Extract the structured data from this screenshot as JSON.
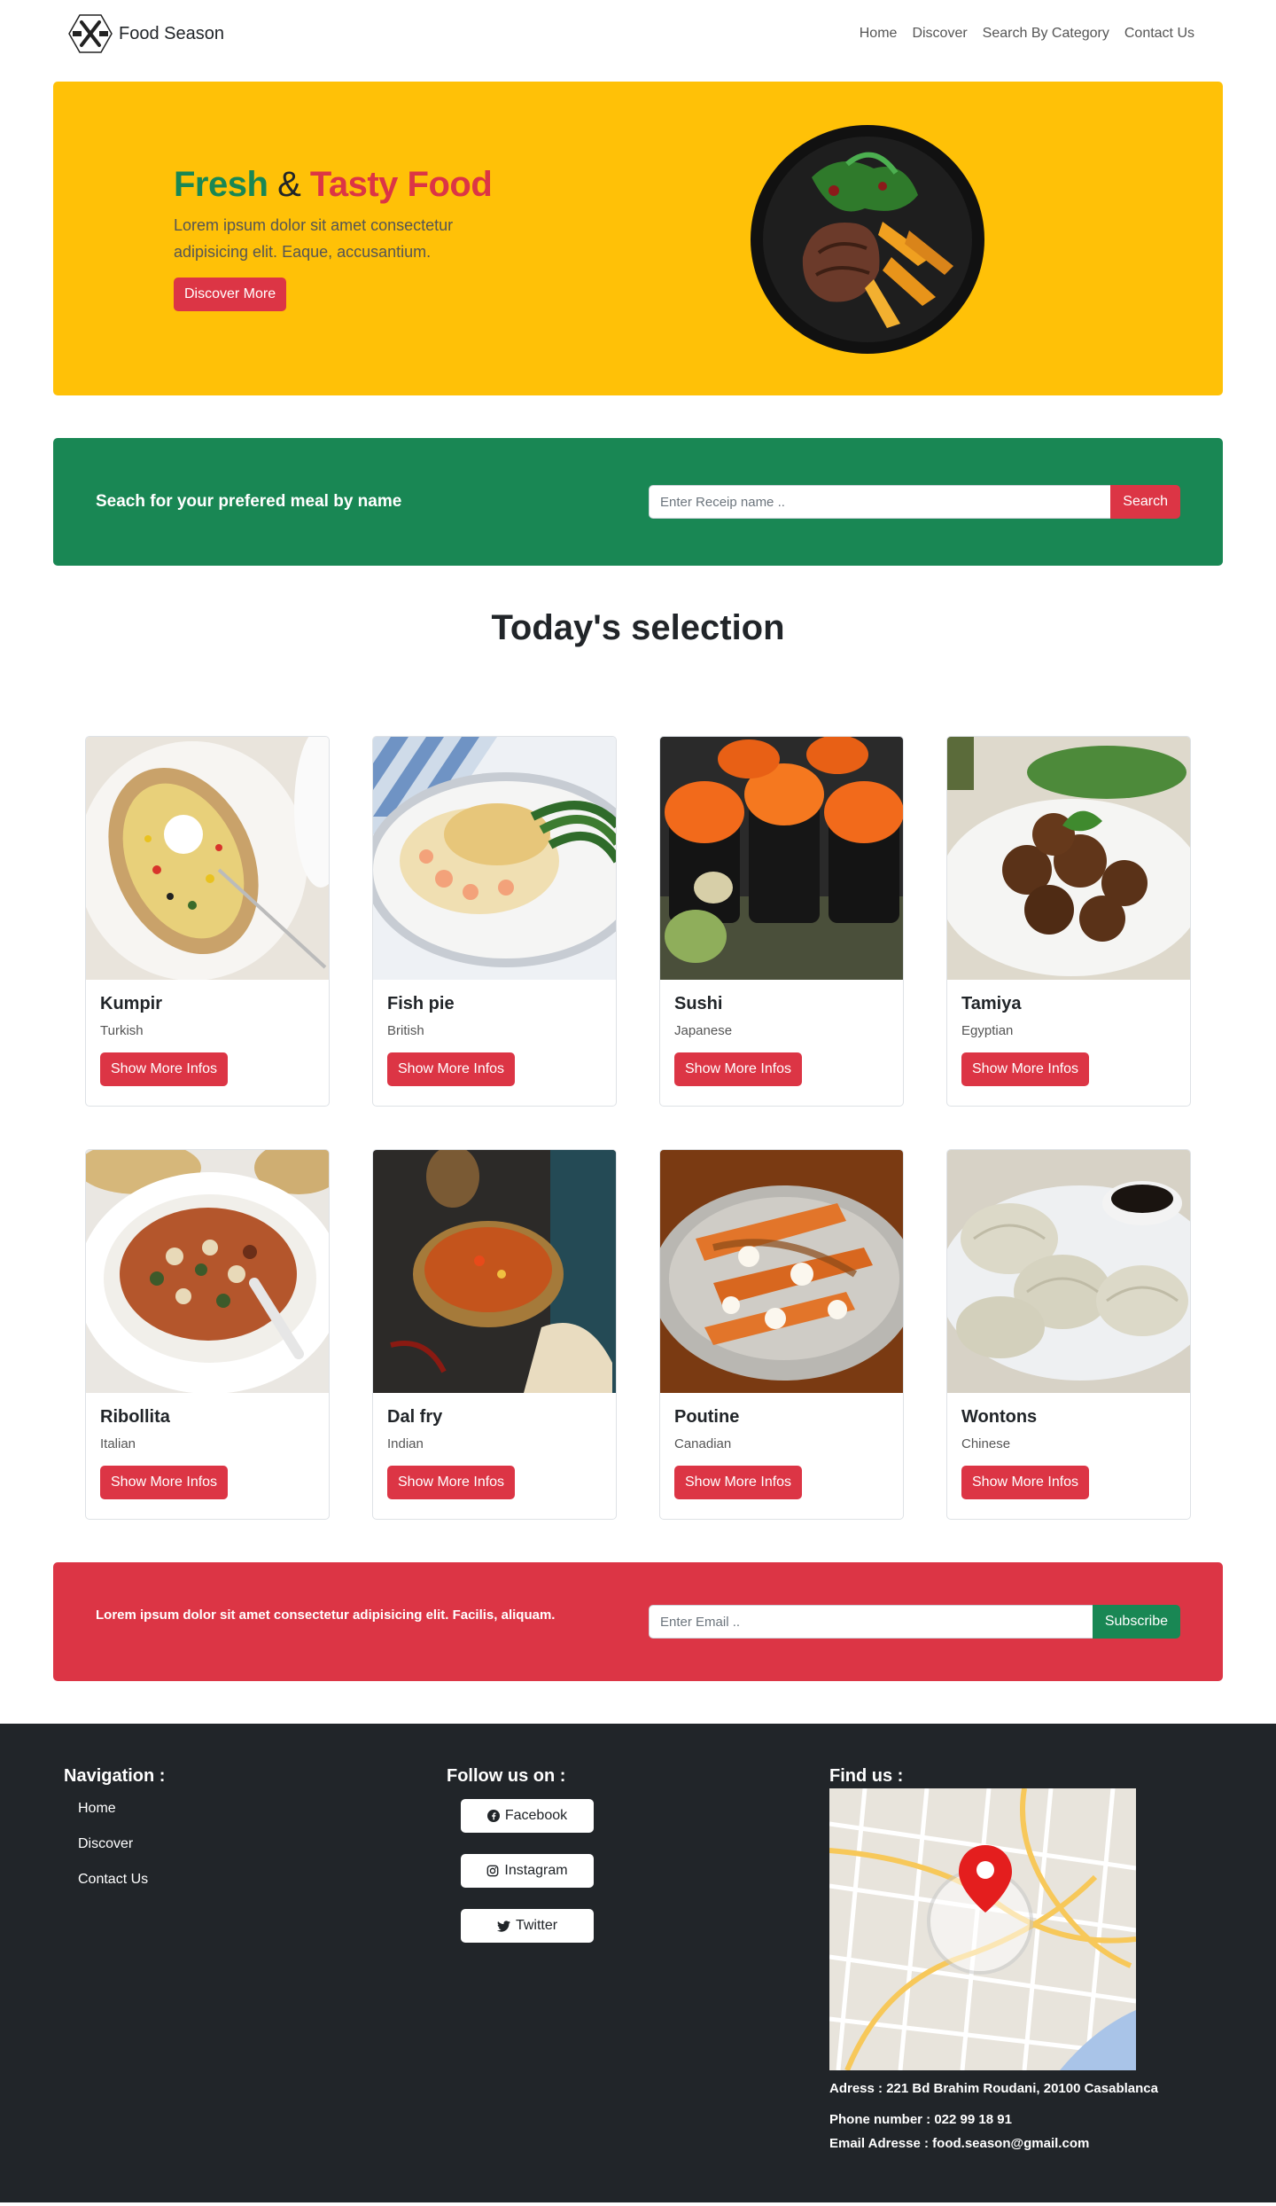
{
  "nav": {
    "brand": "Food Season",
    "links": [
      "Home",
      "Discover",
      "Search By Category",
      "Contact Us"
    ]
  },
  "hero": {
    "title_fresh": "Fresh",
    "title_amp": "&",
    "title_tasty": "Tasty Food",
    "subtitle": "Lorem ipsum dolor sit amet consectetur adipisicing elit. Eaque, accusantium.",
    "button": "Discover More"
  },
  "search": {
    "label": "Seach for your prefered meal by name",
    "placeholder": "Enter Receip name ..",
    "button": "Search"
  },
  "selection": {
    "title": "Today's selection",
    "button": "Show More Infos",
    "cards": [
      {
        "name": "Kumpir",
        "origin": "Turkish"
      },
      {
        "name": "Fish pie",
        "origin": "British"
      },
      {
        "name": "Sushi",
        "origin": "Japanese"
      },
      {
        "name": "Tamiya",
        "origin": "Egyptian"
      },
      {
        "name": "Ribollita",
        "origin": "Italian"
      },
      {
        "name": "Dal fry",
        "origin": "Indian"
      },
      {
        "name": "Poutine",
        "origin": "Canadian"
      },
      {
        "name": "Wontons",
        "origin": "Chinese"
      }
    ]
  },
  "newsletter": {
    "text": "Lorem ipsum dolor sit amet consectetur adipisicing elit. Facilis, aliquam.",
    "placeholder": "Enter Email ..",
    "button": "Subscribe"
  },
  "footer": {
    "nav_title": "Navigation :",
    "nav_links": [
      "Home",
      "Discover",
      "Contact Us"
    ],
    "follow_title": "Follow us on :",
    "social": [
      "Facebook",
      "Instagram",
      "Twitter"
    ],
    "find_title": "Find us :",
    "address": "Adress : 221 Bd Brahim Roudani, 20100 Casablanca",
    "phone": "Phone number : 022 99 18 91",
    "email": "Email Adresse : food.season@gmail.com"
  },
  "colors": {
    "yellow": "#ffc107",
    "green": "#198754",
    "red": "#dc3545",
    "dark": "#212529"
  }
}
